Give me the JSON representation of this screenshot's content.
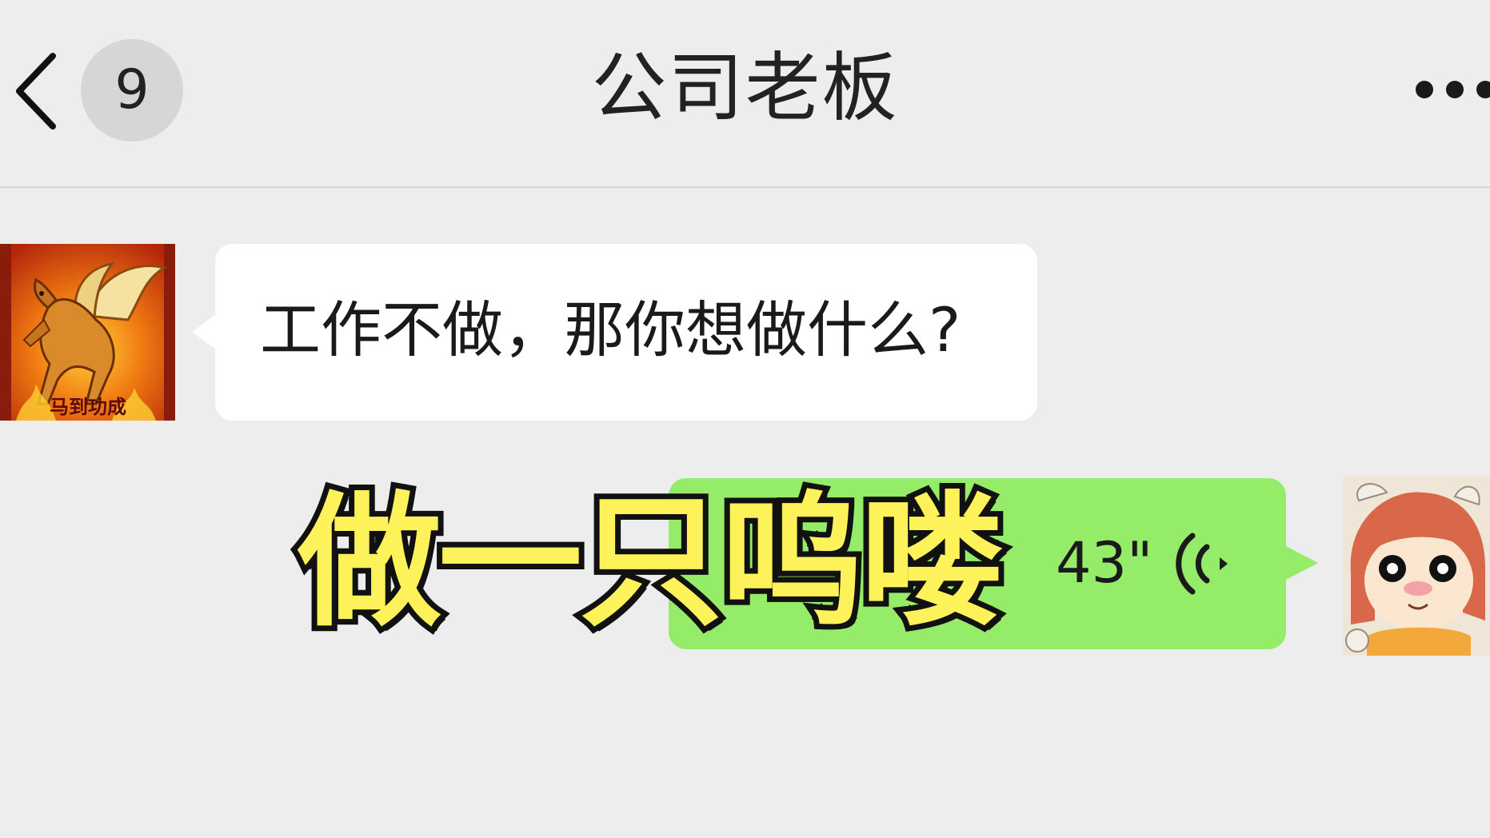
{
  "header": {
    "back_icon": "chevron-left-icon",
    "unread_count": "9",
    "title": "公司老板",
    "more_icon": "ellipsis-icon"
  },
  "messages": [
    {
      "side": "left",
      "type": "text",
      "text": "工作不做，那你想做什么?",
      "avatar": "pegasus-avatar",
      "avatar_text": "马到功成"
    },
    {
      "side": "right",
      "type": "voice",
      "duration": "43\"",
      "icon": "voice-wave-icon",
      "avatar": "cartoon-girl-avatar"
    }
  ],
  "caption": "做一只呜喽",
  "colors": {
    "background": "#ededed",
    "incoming_bubble": "#ffffff",
    "outgoing_bubble": "#95ec69",
    "caption_fill": "#fdf25a",
    "caption_stroke": "#111111"
  }
}
